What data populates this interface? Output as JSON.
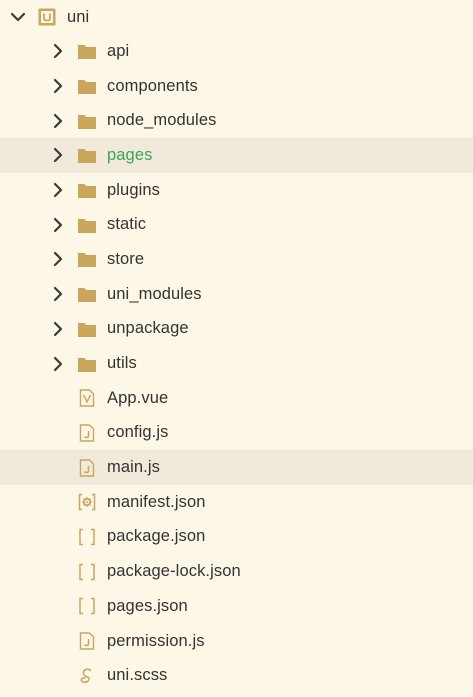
{
  "root": {
    "label": "uni",
    "icon": "uni-app-project-icon",
    "expanded": true
  },
  "folders": [
    {
      "label": "api",
      "icon": "folder-icon"
    },
    {
      "label": "components",
      "icon": "folder-icon"
    },
    {
      "label": "node_modules",
      "icon": "folder-icon"
    },
    {
      "label": "pages",
      "icon": "folder-icon",
      "state": "hover",
      "text_color": "#3aa65a"
    },
    {
      "label": "plugins",
      "icon": "folder-icon"
    },
    {
      "label": "static",
      "icon": "folder-icon"
    },
    {
      "label": "store",
      "icon": "folder-icon"
    },
    {
      "label": "uni_modules",
      "icon": "folder-icon"
    },
    {
      "label": "unpackage",
      "icon": "folder-icon"
    },
    {
      "label": "utils",
      "icon": "folder-icon"
    }
  ],
  "files": [
    {
      "label": "App.vue",
      "icon": "vue-file-icon"
    },
    {
      "label": "config.js",
      "icon": "js-file-icon"
    },
    {
      "label": "main.js",
      "icon": "js-file-icon",
      "state": "selected"
    },
    {
      "label": "manifest.json",
      "icon": "manifest-file-icon"
    },
    {
      "label": "package.json",
      "icon": "json-file-icon"
    },
    {
      "label": "package-lock.json",
      "icon": "json-file-icon"
    },
    {
      "label": "pages.json",
      "icon": "json-file-icon"
    },
    {
      "label": "permission.js",
      "icon": "js-file-icon"
    },
    {
      "label": "uni.scss",
      "icon": "scss-file-icon"
    }
  ],
  "colors": {
    "background": "#fdf7e7",
    "highlight_row": "#f1eadb",
    "folder": "#c9a65c",
    "icon_outline": "#c9a65c",
    "text": "#333333",
    "modified_text": "#3aa65a"
  }
}
